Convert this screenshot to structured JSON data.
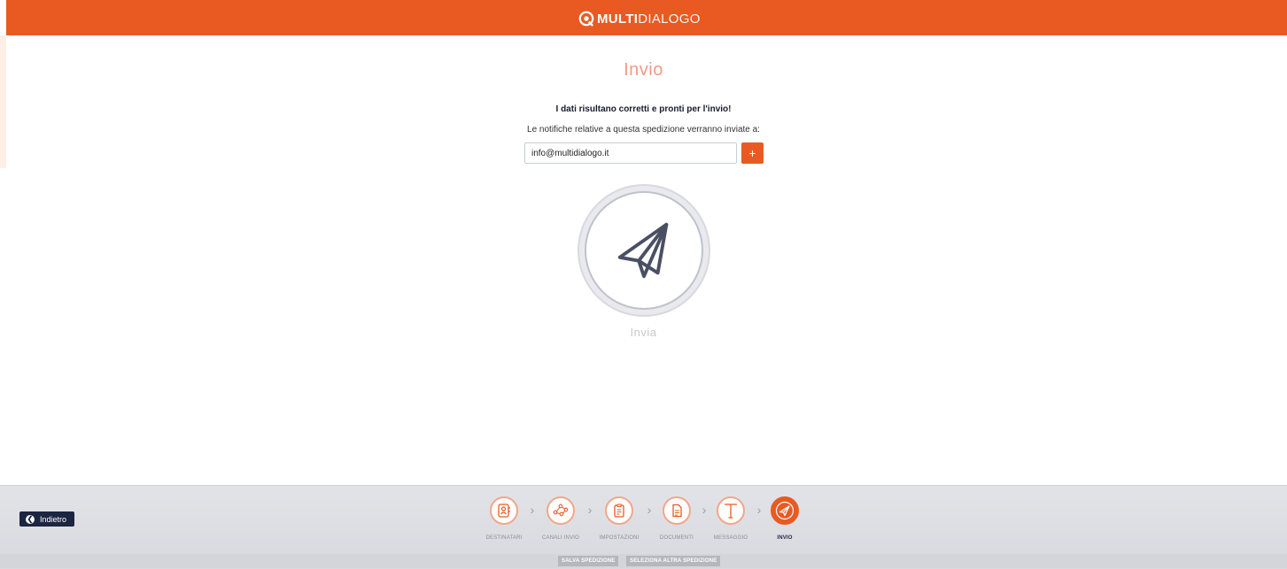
{
  "header": {
    "logo_bold": "MULTI",
    "logo_light": "DIALOGO"
  },
  "main": {
    "title": "Invio",
    "subtitle": "I dati risultano corretti e pronti per l'invio!",
    "notice": "Le notifiche relative a questa spedizione verranno inviate a:",
    "email_value": "info@multidialogo.it",
    "add_label": "+",
    "send_label": "Invia"
  },
  "footer": {
    "back_label": "Indietro",
    "steps": [
      {
        "label": "DESTINATARI",
        "icon": "contacts-icon",
        "active": false
      },
      {
        "label": "CANALI INVIO",
        "icon": "share-nodes-icon",
        "active": false
      },
      {
        "label": "IMPOSTAZIONI",
        "icon": "clipboard-icon",
        "active": false
      },
      {
        "label": "DOCUMENTI",
        "icon": "document-icon",
        "active": false
      },
      {
        "label": "MESSAGGIO",
        "icon": "text-icon",
        "active": false
      },
      {
        "label": "INVIO",
        "icon": "paper-plane-icon",
        "active": true
      }
    ],
    "save_label": "SALVA SPEDIZIONE",
    "select_label": "SELEZIONA ALTRA SPEDIZIONE"
  },
  "colors": {
    "accent": "#e95a22",
    "dark": "#1c2541"
  }
}
